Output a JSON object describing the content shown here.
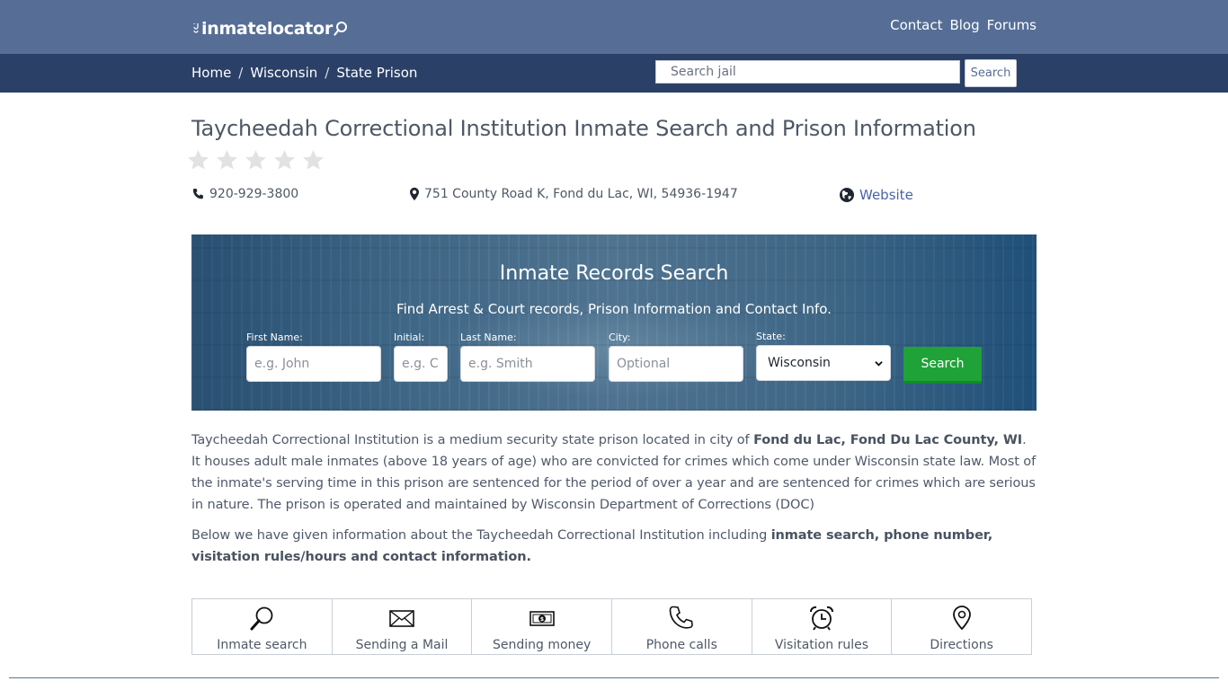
{
  "header": {
    "logo_text": "inmatelocator",
    "nav": [
      "Contact",
      "Blog",
      "Forums"
    ]
  },
  "breadcrumb": {
    "items": [
      "Home",
      "Wisconsin",
      "State Prison"
    ],
    "separator": "/"
  },
  "top_search": {
    "placeholder": "Search jail",
    "button_label": "Search"
  },
  "page": {
    "title": "Taycheedah Correctional Institution Inmate Search and Prison Information",
    "rating": {
      "value": 0,
      "max": 5
    },
    "phone": "920-929-3800",
    "address": "751 County Road K, Fond du Lac, WI, 54936-1947",
    "website_label": "Website"
  },
  "hero": {
    "title": "Inmate Records Search",
    "subtitle": "Find Arrest & Court records, Prison Information and Contact Info.",
    "fields": {
      "first_name": {
        "label": "First Name:",
        "placeholder": "e.g. John"
      },
      "initial": {
        "label": "Initial:",
        "placeholder": "e.g. C"
      },
      "last_name": {
        "label": "Last Name:",
        "placeholder": "e.g. Smith"
      },
      "city": {
        "label": "City:",
        "placeholder": "Optional"
      },
      "state": {
        "label": "State:",
        "value": "Wisconsin"
      }
    },
    "button_label": "Search"
  },
  "body": {
    "p1_a": "Taycheedah Correctional Institution is a medium security state prison located in city of ",
    "p1_b": "Fond du Lac, Fond Du Lac County, WI",
    "p1_c": ". It houses adult male inmates (above 18 years of age) who are convicted for crimes which come under Wisconsin state law. Most of the inmate's serving time in this prison are sentenced for the period of over a year and are sentenced for crimes which are serious in nature. The prison is operated and maintained by Wisconsin Department of Corrections (DOC)",
    "p2_a": "Below we have given information about the Taycheedah Correctional Institution including ",
    "p2_b": "inmate search, phone number, visitation rules/hours and contact information."
  },
  "tiles": [
    {
      "label": "Inmate search",
      "icon": "magnifier-icon"
    },
    {
      "label": "Sending a Mail",
      "icon": "envelope-icon"
    },
    {
      "label": "Sending money",
      "icon": "banknote-icon"
    },
    {
      "label": "Phone calls",
      "icon": "phone-icon"
    },
    {
      "label": "Visitation rules",
      "icon": "alarm-clock-icon"
    },
    {
      "label": "Directions",
      "icon": "map-pin-icon"
    }
  ],
  "colors": {
    "topbar": "#566e96",
    "subbar": "#2a4067",
    "search_green": "#1fa338",
    "link": "#4a62a8"
  }
}
